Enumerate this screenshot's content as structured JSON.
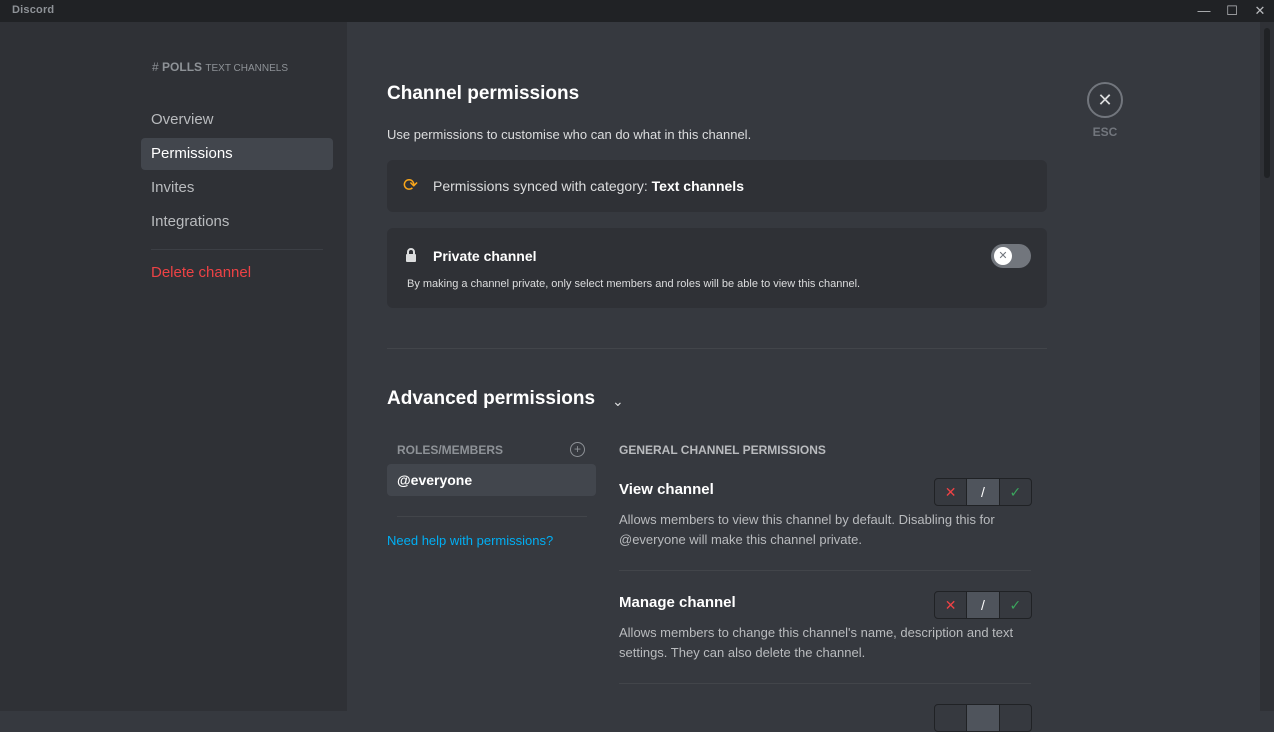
{
  "titlebar": {
    "app_name": "Discord",
    "minimize": "—",
    "maximize": "☐",
    "close": "✕"
  },
  "sidebar": {
    "channel_hash": "#",
    "channel_name": "POLLS",
    "category": "TEXT CHANNELS",
    "items": [
      {
        "label": "Overview"
      },
      {
        "label": "Permissions"
      },
      {
        "label": "Invites"
      },
      {
        "label": "Integrations"
      }
    ],
    "delete_label": "Delete channel"
  },
  "main": {
    "title": "Channel permissions",
    "description": "Use permissions to customise who can do what in this channel.",
    "close_label": "ESC",
    "sync": {
      "text": "Permissions synced with category:",
      "category": "Text channels"
    },
    "private": {
      "title": "Private channel",
      "description": "By making a channel private, only select members and roles will be able to view this channel.",
      "enabled": false
    },
    "advanced_title": "Advanced permissions",
    "roles_header": "ROLES/MEMBERS",
    "roles": [
      {
        "label": "@everyone"
      }
    ],
    "help_link": "Need help with permissions?",
    "perm_section_header": "GENERAL CHANNEL PERMISSIONS",
    "permissions": [
      {
        "name": "View channel",
        "description": "Allows members to view this channel by default. Disabling this for @everyone will make this channel private.",
        "state": "neutral"
      },
      {
        "name": "Manage channel",
        "description": "Allows members to change this channel's name, description and text settings. They can also delete the channel.",
        "state": "neutral"
      }
    ]
  },
  "colors": {
    "accent_sync": "#faa61a",
    "deny": "#ed4245",
    "allow": "#3ba55d",
    "link": "#00aff4"
  }
}
